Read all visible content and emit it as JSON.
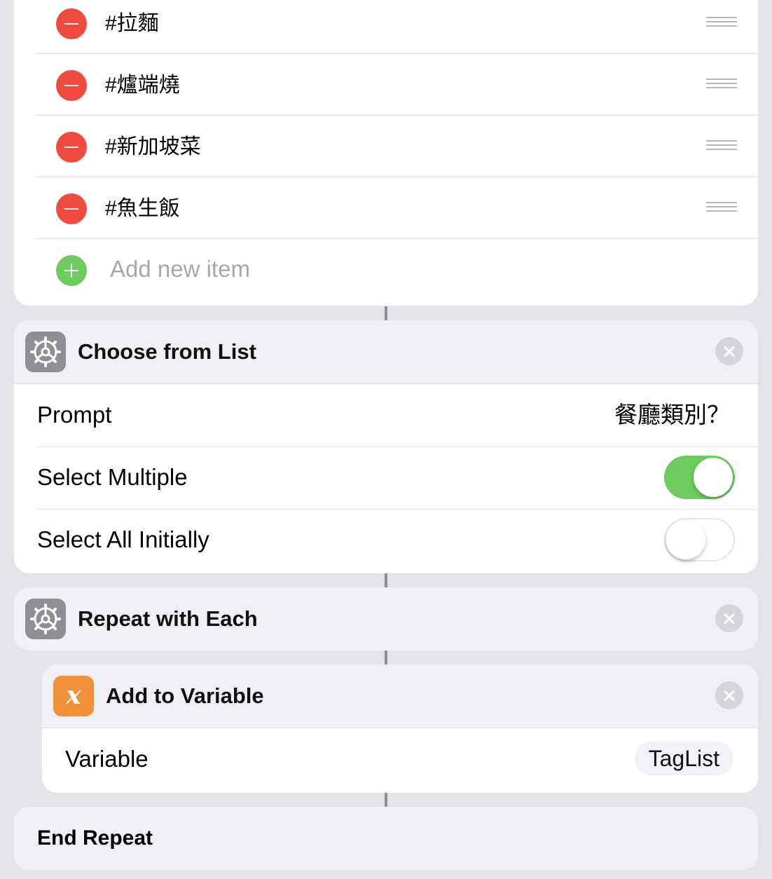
{
  "list": {
    "items": [
      {
        "label": "#拉麵"
      },
      {
        "label": "#爐端燒"
      },
      {
        "label": "#新加坡菜"
      },
      {
        "label": "#魚生飯"
      }
    ],
    "add_placeholder": "Add new item"
  },
  "choose_from_list": {
    "title": "Choose from List",
    "icon": "gear-icon",
    "prompt_label": "Prompt",
    "prompt_value": "餐廳類別？",
    "select_multiple_label": "Select Multiple",
    "select_multiple_on": true,
    "select_all_label": "Select All Initially",
    "select_all_on": false
  },
  "repeat_with_each": {
    "title": "Repeat with Each",
    "icon": "gear-icon"
  },
  "add_to_variable": {
    "title": "Add to Variable",
    "icon": "variable-x-icon",
    "icon_glyph": "x",
    "variable_label": "Variable",
    "variable_value": "TagList"
  },
  "end_repeat": {
    "label": "End Repeat"
  },
  "colors": {
    "background": "#e3e3e8",
    "remove_red": "#f04b3f",
    "add_green": "#6ccc5e",
    "toggle_green": "#6ccc5e",
    "scripting_gray": "#8e8e93",
    "variable_orange": "#f0913a"
  }
}
